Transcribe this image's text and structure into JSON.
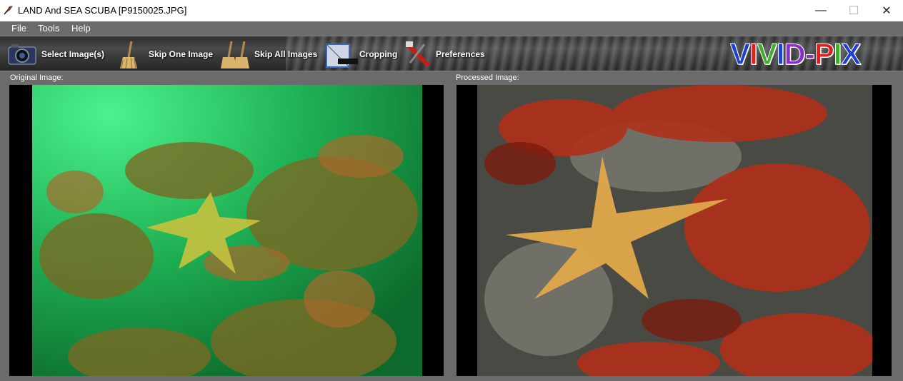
{
  "window": {
    "title": "LAND And SEA SCUBA  [P9150025.JPG]",
    "controls": {
      "minimize": "—",
      "maximize": "☐",
      "close": "✕"
    }
  },
  "menu": {
    "items": [
      "File",
      "Tools",
      "Help"
    ]
  },
  "toolbar": {
    "buttons": [
      {
        "label": "Select Image(s)",
        "icon": "camera-icon"
      },
      {
        "label": "Skip One Image",
        "icon": "broom-icon"
      },
      {
        "label": "Skip All Images",
        "icon": "brooms-icon"
      },
      {
        "label": "Cropping",
        "icon": "crop-icon"
      },
      {
        "label": "Preferences",
        "icon": "tools-icon"
      }
    ],
    "logo": {
      "part1": "VIVID",
      "dash": "-",
      "part2": "PIX"
    }
  },
  "colors": {
    "logo_blue": "#1f3fd1",
    "logo_green": "#3fae2a",
    "logo_red": "#e02020",
    "logo_purple": "#8b2fc9"
  },
  "panels": {
    "original_label": "Original Image:",
    "processed_label": "Processed Image:"
  }
}
